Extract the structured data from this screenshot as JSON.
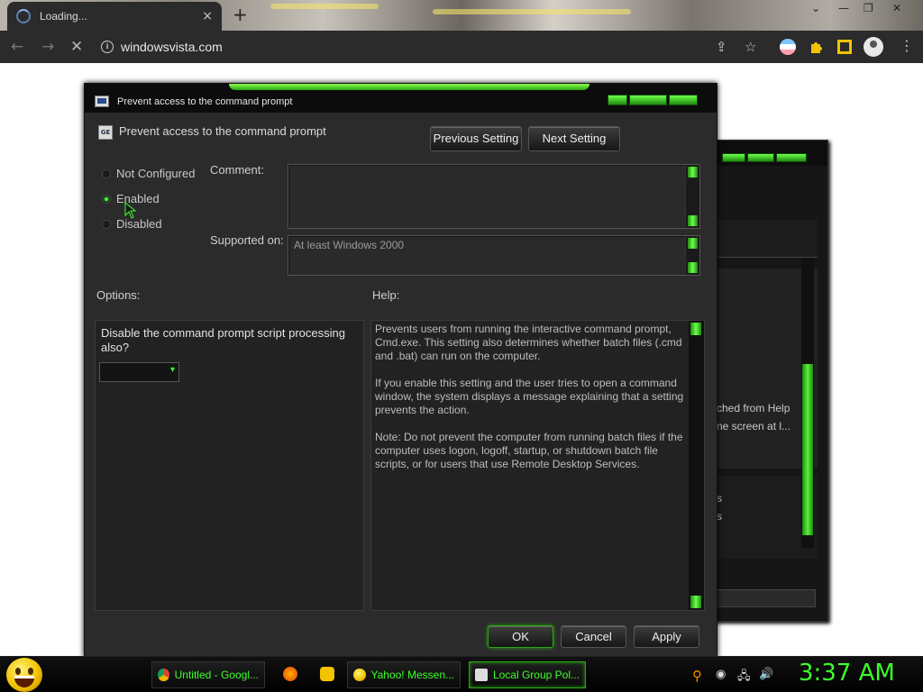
{
  "browser": {
    "tab_title": "Loading...",
    "tab_close": "×",
    "new_tab": "+",
    "url": "windowsvista.com",
    "win_minimize": "—",
    "win_restore": "❐",
    "win_close": "✕",
    "back": "←",
    "forward": "→",
    "stop": "✕",
    "info": "i",
    "share": "⇪",
    "star": "☆",
    "menu": "⋮"
  },
  "dialog": {
    "window_title": "Prevent access to the command prompt",
    "setting_name": "Prevent access to the command prompt",
    "setting_icon": "GE",
    "prev_button": "Previous Setting",
    "next_button": "Next Setting",
    "radios": [
      {
        "label": "Not Configured",
        "checked": false
      },
      {
        "label": "Enabled",
        "checked": true
      },
      {
        "label": "Disabled",
        "checked": false
      }
    ],
    "comment_label": "Comment:",
    "comment_value": "",
    "supported_label": "Supported on:",
    "supported_value": "At least Windows 2000",
    "options_label": "Options:",
    "help_label": "Help:",
    "option_question": "Disable the command prompt script processing also?",
    "option_value": "",
    "help_paragraphs": [
      "Prevents users from running the interactive command prompt, Cmd.exe. This setting also determines whether batch files (.cmd and .bat) can run on the computer.",
      "If you enable this setting and the user tries to open a command window, the system displays a message explaining that a setting prevents the action.",
      "Note: Do not prevent the computer from running batch files if the computer uses logon, logoff, startup, or shutdown batch file scripts, or for users that use Remote Desktop Services."
    ],
    "ok_button": "OK",
    "cancel_button": "Cancel",
    "apply_button": "Apply"
  },
  "back_dialog": {
    "text1": "ched from Help",
    "text2": "ne screen at l...",
    "text3": "s",
    "text4": "s"
  },
  "taskbar": {
    "items": [
      {
        "label": "Untitled - Googl..."
      },
      {
        "label": "Yahoo! Messen..."
      },
      {
        "label": "Local Group Pol..."
      }
    ],
    "clock": "3:37 AM"
  },
  "colors": {
    "accent_green": "#3cff2a",
    "dialog_bg": "#2b2b2b",
    "chrome_dark": "#2b2b2b"
  }
}
